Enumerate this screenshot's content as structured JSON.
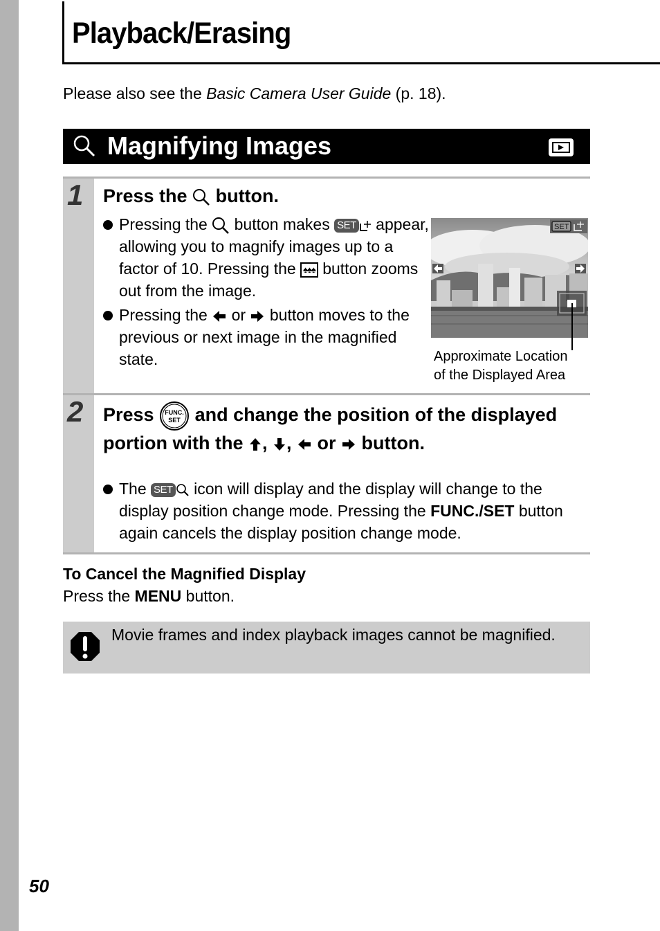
{
  "page": {
    "title": "Playback/Erasing",
    "intro_prefix": "Please also see the ",
    "intro_italic": "Basic Camera User Guide",
    "intro_suffix": " (p. 18).",
    "page_number": "50"
  },
  "section": {
    "title": "Magnifying Images",
    "mode_icon": "playback-mode-icon"
  },
  "steps": [
    {
      "number": "1",
      "heading_prefix": "Press the ",
      "heading_icon": "magnify-icon",
      "heading_suffix": " button.",
      "bullets": [
        {
          "part1": "Pressing the ",
          "part2": " button makes ",
          "set_badge": "SET",
          "part3": " appear, allowing you to magnify images up to a factor of 10. Pressing the ",
          "index_icon": "♠♠♠",
          "part4": " button zooms out from the image."
        },
        {
          "part1": "Pressing the ",
          "part2": " or ",
          "part3": " button moves to the previous or next image in the magnified state."
        }
      ],
      "figure": {
        "overlay_badge": "SET",
        "caption_line1": "Approximate Location",
        "caption_line2": "of the Displayed Area"
      }
    },
    {
      "number": "2",
      "heading_prefix": "Press ",
      "func_label_top": "FUNC.",
      "func_label_bottom": "SET",
      "heading_mid": " and change the position of the displayed portion with the ",
      "heading_comma": ", ",
      "heading_or": " or ",
      "heading_suffix": " button.",
      "bullets": [
        {
          "part1": "The ",
          "set_badge": "SET",
          "part2": " icon will display and the display will change to the display position change mode. Pressing the ",
          "bold": "FUNC./SET",
          "part3": " button again cancels the display position change mode."
        }
      ]
    }
  ],
  "cancel": {
    "heading": "To Cancel the Magnified Display",
    "body_prefix": "Press the ",
    "body_bold": "MENU",
    "body_suffix": " button."
  },
  "note": {
    "text": "Movie frames and index playback images cannot be magnified."
  }
}
